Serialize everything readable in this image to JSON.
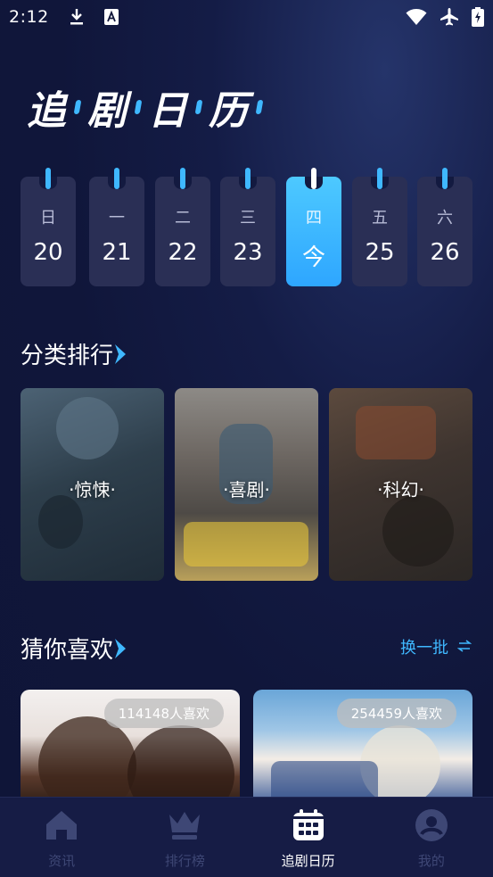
{
  "status_bar": {
    "time": "2:12",
    "icons": [
      "download-icon",
      "font-a-icon",
      "wifi-icon",
      "airplane-icon",
      "battery-charging-icon"
    ]
  },
  "page_title": [
    "追",
    "剧",
    "日",
    "历"
  ],
  "calendar": {
    "days": [
      {
        "weekday": "日",
        "date": "20",
        "active": false
      },
      {
        "weekday": "一",
        "date": "21",
        "active": false
      },
      {
        "weekday": "二",
        "date": "22",
        "active": false
      },
      {
        "weekday": "三",
        "date": "23",
        "active": false
      },
      {
        "weekday": "四",
        "date": "今",
        "active": true
      },
      {
        "weekday": "五",
        "date": "25",
        "active": false
      },
      {
        "weekday": "六",
        "date": "26",
        "active": false
      }
    ]
  },
  "category_section": {
    "title": "分类排行",
    "cards": [
      {
        "label": "·惊悚·"
      },
      {
        "label": "·喜剧·"
      },
      {
        "label": "·科幻·"
      }
    ]
  },
  "recommend_section": {
    "title": "猜你喜欢",
    "refresh_label": "换一批",
    "cards": [
      {
        "likes": "114148人喜欢"
      },
      {
        "likes": "254459人喜欢"
      }
    ]
  },
  "bottom_nav": {
    "items": [
      {
        "label": "资讯",
        "icon": "home-icon",
        "active": false
      },
      {
        "label": "排行榜",
        "icon": "crown-icon",
        "active": false
      },
      {
        "label": "追剧日历",
        "icon": "calendar-icon",
        "active": true
      },
      {
        "label": "我的",
        "icon": "profile-icon",
        "active": false
      }
    ]
  },
  "colors": {
    "background": "#10163a",
    "accent": "#3fb8ff",
    "card": "#2a2f55",
    "nav_inactive": "#3e4775"
  }
}
